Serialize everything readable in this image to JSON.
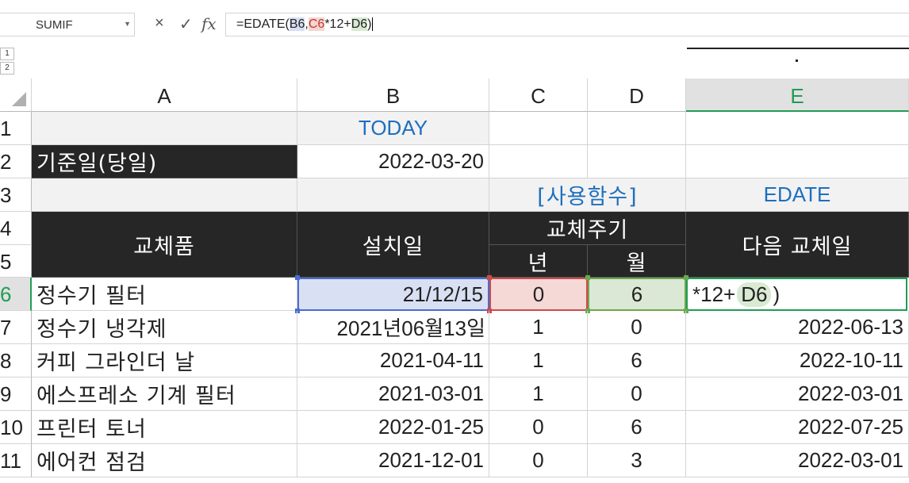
{
  "formula_bar": {
    "name_box": "SUMIF",
    "cancel_icon": "×",
    "enter_icon": "✓",
    "fx_label": "fx",
    "formula_parts": [
      "=EDATE(",
      "B6",
      ",",
      "C6",
      "*12+",
      "D6",
      ")"
    ]
  },
  "outline": {
    "levels": [
      "1",
      "2"
    ]
  },
  "columns": [
    "A",
    "B",
    "C",
    "D",
    "E"
  ],
  "rows": [
    "1",
    "2",
    "3",
    "4",
    "5",
    "6",
    "7",
    "8",
    "9",
    "10",
    "11"
  ],
  "sheet": {
    "b1": "TODAY",
    "a2": "기준일(당일)",
    "b2": "2022-03-20",
    "c3": "[사용함수]",
    "e3": "EDATE",
    "h_item": "교체품",
    "h_install": "설치일",
    "h_cycle": "교체주기",
    "h_next": "다음 교체일",
    "h_year": "년",
    "h_month": "월",
    "row6": {
      "item": "정수기 필터",
      "install": "21/12/15",
      "year": "0",
      "month": "6",
      "edit_prefix": "*12+",
      "edit_ref": "D6",
      "edit_suffix": ")"
    },
    "data_rows": [
      {
        "item": "정수기 냉각제",
        "install": "2021년06월13일",
        "year": "1",
        "month": "0",
        "next": "2022-06-13"
      },
      {
        "item": "커피 그라인더 날",
        "install": "2021-04-11",
        "year": "1",
        "month": "6",
        "next": "2022-10-11"
      },
      {
        "item": "에스프레소 기계 필터",
        "install": "2021-03-01",
        "year": "1",
        "month": "0",
        "next": "2022-03-01"
      },
      {
        "item": "프린터 토너",
        "install": "2022-01-25",
        "year": "0",
        "month": "6",
        "next": "2022-07-25"
      },
      {
        "item": "에어컨 점검",
        "install": "2021-12-01",
        "year": "0",
        "month": "3",
        "next": "2022-03-01"
      }
    ]
  }
}
